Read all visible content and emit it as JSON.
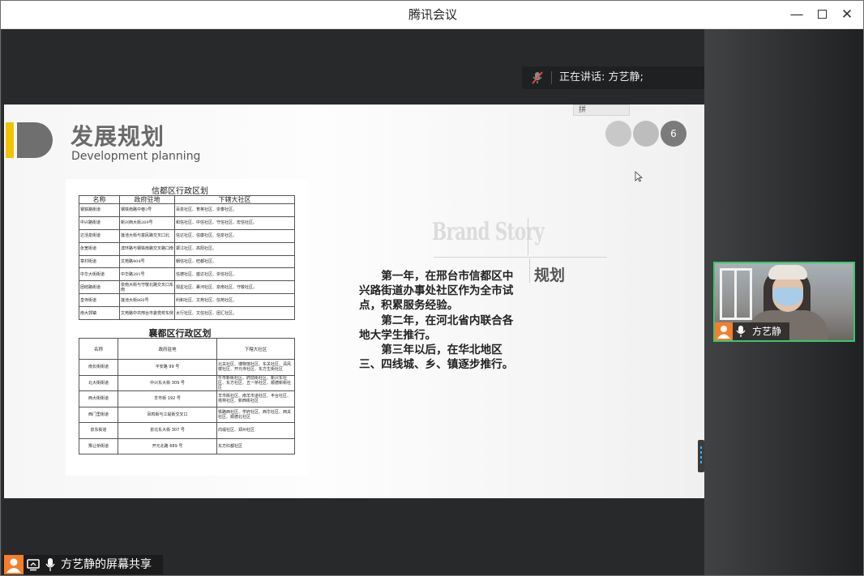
{
  "window": {
    "title": "腾讯会议"
  },
  "meeting": {
    "speaking": "正在讲话: 方艺静;"
  },
  "slide": {
    "title": "发展规划",
    "subtitle": "Development planning",
    "page_number": "6",
    "ime_hint": "拼",
    "brand_story": "Brand Story",
    "section_label": "规划",
    "paragraphs": [
      "第一年，在邢台市信都区中兴路街道办事处社区作为全市试点，积累服务经验。",
      "第二年，在河北省内联合各地大学生推行。",
      "第三年以后，在华北地区三、四线城、乡、镇逐步推行。"
    ],
    "table1": {
      "title": "信都区行政区划",
      "headers": [
        "名称",
        "政府驻地",
        "下辖大社区"
      ],
      "rows": [
        [
          "钢铁路街道",
          "钢铁南路中巷3号",
          "百泉社区、育英社区、崇泰社区。"
        ],
        [
          "中兴路街道",
          "新兴西大街269号",
          "和信社区、中信社区、守信社区、宏信社区。"
        ],
        [
          "达活泉街道",
          "莲池大街与富民路交叉口北",
          "信达社区、信康社区、信泉社区。"
        ],
        [
          "张宽街道",
          "滨环路与钢铁南路交叉路口南",
          "振江社区、高阳社区。"
        ],
        [
          "章村街道",
          "文苑路404号",
          "朝信社区、旺都社区。"
        ],
        [
          "中华大街街道",
          "中华路281号",
          "信德社区、盛达社区、崇信社区。"
        ],
        [
          "团结路街道",
          "泉南大街与守敬北路交叉口东南",
          "观星社区、裹河社区、泉南社区、守敬社区。"
        ],
        [
          "皇寺街道",
          "莲池大街866号",
          "利和社区、文苑社区、信苑社区。"
        ],
        [
          "南大郭镇",
          "文苑路中共邢台市委党校东侧",
          "太行社区、文信社区、团汇社区。"
        ]
      ]
    },
    "table2": {
      "title": "襄都区行政区划",
      "headers": [
        "名称",
        "政府驻地",
        "下辖大社区"
      ],
      "rows": [
        [
          "南长街街道",
          "平安路 99 号",
          "北关社区、博物馆社区、东关社区、清风楼社区、开元寺社区、东方生街社区"
        ],
        [
          "北大街街道",
          "中兴东大街 309 号",
          "牛市新街社区、府前街社区、新兴东社区、东方社区、五一桥社区、顺德新街社区"
        ],
        [
          "西大街街道",
          "羊市街 192 号",
          "羊市街社区、南羊市道社区、丰台社区、塔林社区、新西街社区"
        ],
        [
          "西门里街道",
          "凤鸣街与江堤街交叉口",
          "铁路西社区、学府社区、西华社区、西关社区、顺德北社区"
        ],
        [
          "泉东街道",
          "泉北东大街 307 号",
          "向堤社区、郑州社区"
        ],
        [
          "豫让桥街道",
          "开元北路 689 号",
          "东方红都社区"
        ]
      ]
    }
  },
  "participant": {
    "name": "方艺静"
  },
  "share": {
    "label": "方艺静的屏幕共享"
  },
  "colors": {
    "active_border": "#3cc56a",
    "avatar": "#f57e2c",
    "logo_yellow": "#f0c400",
    "handle_accent": "#3bb3ff"
  }
}
